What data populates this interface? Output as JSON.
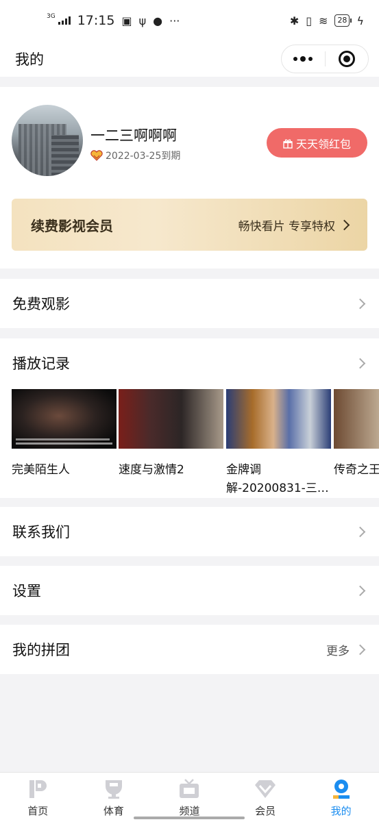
{
  "status_bar": {
    "signal": "3G",
    "time": "17:15",
    "battery": "28"
  },
  "navbar": {
    "title": "我的"
  },
  "profile": {
    "username": "一二三啊啊啊",
    "expire_text": "2022-03-25到期",
    "red_packet_button": "天天领红包"
  },
  "vip_banner": {
    "label": "续费影视会员",
    "perk": "畅快看片 专享特权"
  },
  "menu": {
    "free_watch": "免费观影",
    "history": "播放记录",
    "contact": "联系我们",
    "settings": "设置",
    "group_buy": "我的拼团",
    "group_buy_more": "更多"
  },
  "history_items": [
    {
      "title": "完美陌生人"
    },
    {
      "title": "速度与激情2"
    },
    {
      "title": "金牌调解-20200831-三…"
    },
    {
      "title": "传奇之王"
    }
  ],
  "tabs": [
    {
      "label": "首页",
      "icon": "home-icon"
    },
    {
      "label": "体育",
      "icon": "sports-icon"
    },
    {
      "label": "频道",
      "icon": "tv-icon"
    },
    {
      "label": "会员",
      "icon": "diamond-icon"
    },
    {
      "label": "我的",
      "icon": "profile-icon"
    }
  ],
  "colors": {
    "accent": "#1b8df0",
    "red_button": "#f06a68",
    "vip_text": "#3a2f1c"
  }
}
